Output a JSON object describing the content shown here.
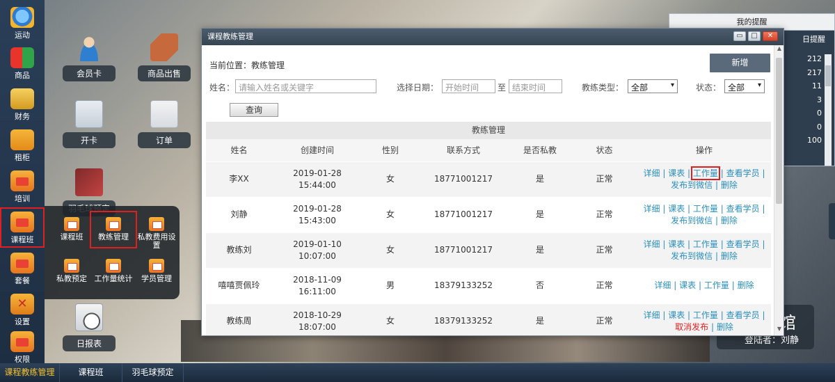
{
  "dock": [
    {
      "label": "运动",
      "icon": "globe-icon"
    },
    {
      "label": "商品",
      "icon": "grid-icon"
    },
    {
      "label": "财务",
      "icon": "money-icon"
    },
    {
      "label": "租柜",
      "icon": "locker-icon"
    },
    {
      "label": "培训",
      "icon": "chart-icon"
    },
    {
      "label": "课程班",
      "icon": "chart-icon"
    },
    {
      "label": "套餐",
      "icon": "chart-icon"
    },
    {
      "label": "设置",
      "icon": "tools-icon"
    },
    {
      "label": "权限",
      "icon": "chart-icon"
    }
  ],
  "desktop": {
    "member_card": "会员卡",
    "product_sale": "商品出售",
    "open_card": "开卡",
    "order": "订单",
    "badminton_booking_partial": "羽毛球预定",
    "daily_report": "日报表"
  },
  "flyout": [
    {
      "label": "课程班"
    },
    {
      "label": "教练管理"
    },
    {
      "label": "私教费用设置"
    },
    {
      "label": "私教预定"
    },
    {
      "label": "工作量统计"
    },
    {
      "label": "学员管理"
    }
  ],
  "taskbar": [
    {
      "label": "课程教练管理"
    },
    {
      "label": "课程班"
    },
    {
      "label": "羽毛球预定"
    }
  ],
  "reminder": {
    "title": "我的提醒",
    "sub": "日提醒",
    "values": [
      "212",
      "217",
      "11",
      "3",
      "0",
      "0",
      "100"
    ]
  },
  "venue": {
    "name_partial": "场馆",
    "login": "登陆者：刘静"
  },
  "window": {
    "title": "课程教练管理",
    "location": "当前位置：教练管理",
    "new_button": "新增",
    "filters": {
      "name_label": "姓名：",
      "name_placeholder": "请输入姓名或关键字",
      "date_label": "选择日期：",
      "start_placeholder": "开始时间",
      "to": "至",
      "end_placeholder": "结束时间",
      "type_label": "教练类型：",
      "type_value": "全部",
      "status_label": "状态：",
      "status_value": "全部",
      "query_button": "查询"
    },
    "table": {
      "caption": "教练管理",
      "headers": [
        "姓名",
        "创建时间",
        "性别",
        "联系方式",
        "是否私教",
        "状态",
        "操作"
      ],
      "rows": [
        {
          "name": "李XX",
          "date": "2019-01-28",
          "time": "15:44:00",
          "gender": "女",
          "phone": "18771001217",
          "private": "是",
          "status": "正常"
        },
        {
          "name": "刘静",
          "date": "2019-01-28",
          "time": "15:43:00",
          "gender": "女",
          "phone": "18771001217",
          "private": "是",
          "status": "正常"
        },
        {
          "name": "教练刘",
          "date": "2019-01-10",
          "time": "10:07:00",
          "gender": "女",
          "phone": "18771001217",
          "private": "是",
          "status": "正常"
        },
        {
          "name": "嘻嘻贾佩玲",
          "date": "2018-11-09",
          "time": "16:11:00",
          "gender": "男",
          "phone": "18379133252",
          "private": "否",
          "status": "正常"
        },
        {
          "name": "教练周",
          "date": "2018-10-29",
          "time": "18:07:00",
          "gender": "女",
          "phone": "18379133252",
          "private": "是",
          "status": "正常"
        }
      ],
      "ops": {
        "detail": "详细",
        "schedule": "课表",
        "workload": "工作量",
        "view_students": "查看学员",
        "publish": "发布到微信",
        "unpublish": "取消发布",
        "delete": "删除",
        "sep": "|"
      }
    }
  }
}
